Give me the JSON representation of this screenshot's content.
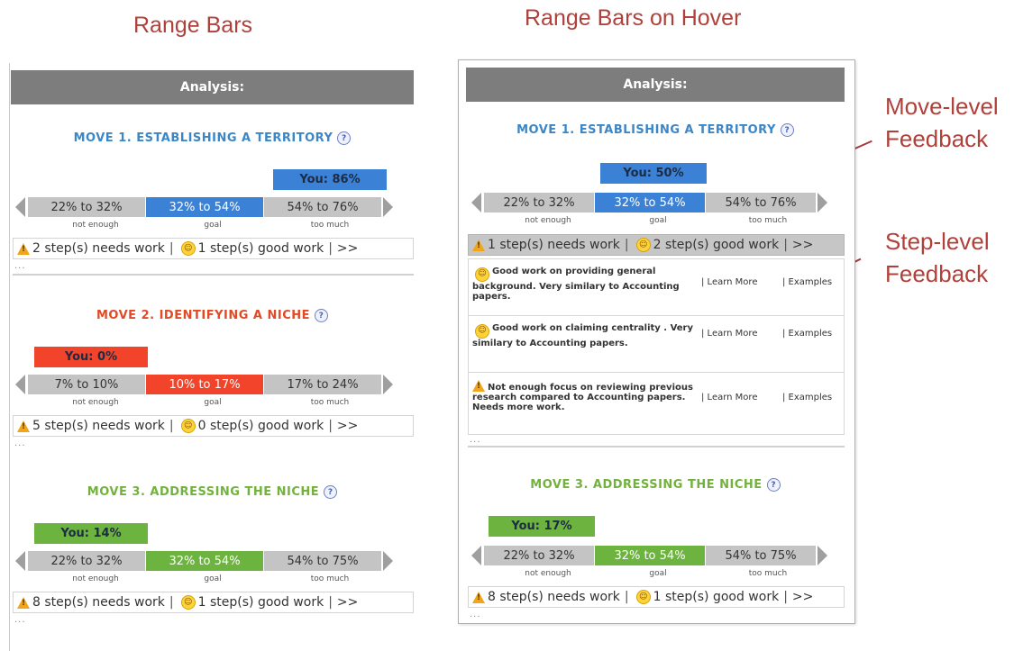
{
  "captions": {
    "left": "Range Bars",
    "right": "Range Bars on Hover"
  },
  "annotations": {
    "move_level": [
      "Move-level",
      "Feedback"
    ],
    "step_level": [
      "Step-level",
      "Feedback"
    ]
  },
  "colors": {
    "blue": "#3b82d6",
    "red": "#f2442a",
    "green": "#6db33f",
    "title_blue": "#3d86c6",
    "title_red": "#e14a25",
    "title_green": "#72b23c",
    "annotation": "#b0403a"
  },
  "left_panel": {
    "header": "Analysis:",
    "moves": [
      {
        "title": "MOVE 1. ESTABLISHING A TERRITORY",
        "you": "You: 86%",
        "ranges": [
          "22% to 32%",
          "32% to 54%",
          "54% to 76%"
        ],
        "sublabels": [
          "not enough",
          "goal",
          "too much"
        ],
        "needs_work": "2 step(s) needs work",
        "good_work": "1 step(s) good work",
        "more": ">>",
        "dots": "..."
      },
      {
        "title": "MOVE 2. IDENTIFYING A NICHE",
        "you": "You: 0%",
        "ranges": [
          "7% to 10%",
          "10% to 17%",
          "17% to 24%"
        ],
        "sublabels": [
          "not enough",
          "goal",
          "too much"
        ],
        "needs_work": "5 step(s) needs work",
        "good_work": "0 step(s) good work",
        "more": ">>",
        "dots": "..."
      },
      {
        "title": "MOVE 3. ADDRESSING THE NICHE",
        "you": "You: 14%",
        "ranges": [
          "22% to 32%",
          "32% to 54%",
          "54% to 75%"
        ],
        "sublabels": [
          "not enough",
          "goal",
          "too much"
        ],
        "needs_work": "8 step(s) needs work",
        "good_work": "1 step(s) good work",
        "more": ">>",
        "dots": "..."
      }
    ]
  },
  "right_panel": {
    "header": "Analysis:",
    "move1": {
      "title": "MOVE 1. ESTABLISHING A TERRITORY",
      "you": "You: 50%",
      "ranges": [
        "22% to 32%",
        "32% to 54%",
        "54% to 76%"
      ],
      "sublabels": [
        "not enough",
        "goal",
        "too much"
      ],
      "needs_work": "1 step(s) needs work",
      "good_work": "2 step(s) good work",
      "more": ">>",
      "dots": "...",
      "feedback": [
        {
          "text": "Good work on providing general background. Very similary to Accounting papers.",
          "learn": "| Learn More",
          "examples": "| Examples"
        },
        {
          "text": "Good work on claiming centrality . Very similary to Accounting papers.",
          "learn": "| Learn More",
          "examples": "| Examples"
        },
        {
          "text": "Not enough focus on reviewing previous research compared to Accounting papers. Needs more work.",
          "learn": "| Learn More",
          "examples": "| Examples"
        }
      ]
    },
    "move3": {
      "title": "MOVE 3. ADDRESSING THE NICHE",
      "you": "You: 17%",
      "ranges": [
        "22% to 32%",
        "32% to 54%",
        "54% to 75%"
      ],
      "sublabels": [
        "not enough",
        "goal",
        "too much"
      ],
      "needs_work": "8 step(s) needs work",
      "good_work": "1 step(s) good work",
      "more": ">>",
      "dots": "..."
    }
  }
}
